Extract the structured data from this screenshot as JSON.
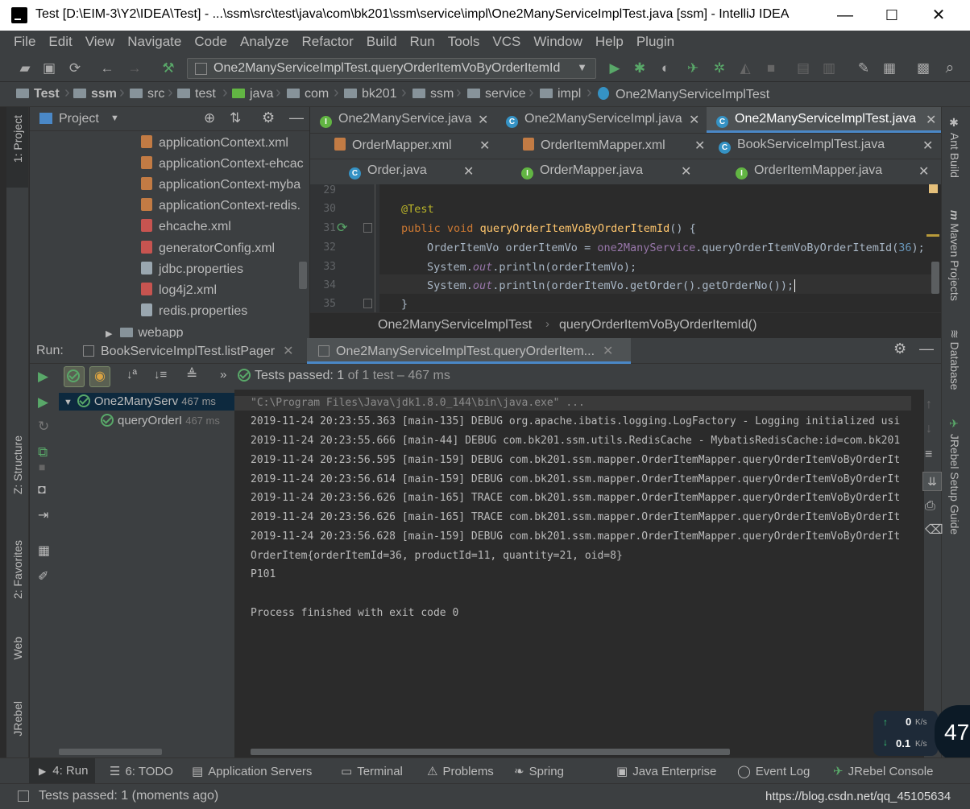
{
  "window": {
    "title": "Test [D:\\EIM-3\\Y2\\IDEA\\Test] - ...\\ssm\\src\\test\\java\\com\\bk201\\ssm\\service\\impl\\One2ManyServiceImplTest.java [ssm] - IntelliJ IDEA",
    "minimize": "—",
    "maximize": "☐",
    "close": "✕"
  },
  "menu": [
    "File",
    "Edit",
    "View",
    "Navigate",
    "Code",
    "Analyze",
    "Refactor",
    "Build",
    "Run",
    "Tools",
    "VCS",
    "Window",
    "Help",
    "Plugin"
  ],
  "toolbar": {
    "run_config": "One2ManyServiceImplTest.queryOrderItemVoByOrderItemId"
  },
  "breadcrumbs": [
    "Test",
    "ssm",
    "src",
    "test",
    "java",
    "com",
    "bk201",
    "ssm",
    "service",
    "impl",
    "One2ManyServiceImplTest"
  ],
  "project": {
    "title": "Project",
    "files": [
      "applicationContext.xml",
      "applicationContext-ehcac",
      "applicationContext-myba",
      "applicationContext-redis.",
      "ehcache.xml",
      "generatorConfig.xml",
      "jdbc.properties",
      "log4j2.xml",
      "redis.properties"
    ],
    "partial_folder": "webapp"
  },
  "left_stripe": {
    "project": "1: Project",
    "structure": "Z: Structure",
    "favorites": "2: Favorites",
    "web": "Web",
    "jrebel": "JRebel"
  },
  "right_stripe": {
    "ant": "Ant Build",
    "maven": "Maven Projects",
    "database": "Database",
    "jrebel": "JRebel Setup Guide"
  },
  "editor_tabs": {
    "row1": [
      "One2ManyService.java",
      "One2ManyServiceImpl.java",
      "One2ManyServiceImplTest.java"
    ],
    "row2": [
      "OrderMapper.xml",
      "OrderItemMapper.xml",
      "BookServiceImplTest.java"
    ],
    "row3": [
      "Order.java",
      "OrderMapper.java",
      "OrderItemMapper.java"
    ]
  },
  "code": {
    "lines": [
      "29",
      "30",
      "31",
      "32",
      "33",
      "34",
      "35"
    ],
    "annotation": "@Test",
    "kw_public": "public",
    "kw_void": "void",
    "method": "queryOrderItemVoByOrderItemId",
    "sig_tail": "() {",
    "l32a": "OrderItemVo orderItemVo = ",
    "l32b": "one2ManyService",
    "l32c": ".queryOrderItemVoByOrderItemId(",
    "l32d": "36",
    "l32e": ");",
    "sys": "System.",
    "out": "out",
    "l33tail": ".println(orderItemVo);",
    "l34tail": ".println(orderItemVo.getOrder().getOrderNo());",
    "close": "}"
  },
  "editor_breadcrumb": {
    "class": "One2ManyServiceImplTest",
    "method": "queryOrderItemVoByOrderItemId()"
  },
  "run": {
    "label": "Run:",
    "tab1": "BookServiceImplTest.listPager",
    "tab2": "One2ManyServiceImplTest.queryOrderItem...",
    "status_prefix": "Tests passed: ",
    "status_count": "1",
    "status_suffix": " of 1 test – 467 ms",
    "tree": [
      {
        "name": "One2ManyServ",
        "time": "467 ms"
      },
      {
        "name": "queryOrderI",
        "time": "467 ms"
      }
    ]
  },
  "console": [
    "\"C:\\Program Files\\Java\\jdk1.8.0_144\\bin\\java.exe\" ...",
    "2019-11-24 20:23:55.363 [main-135] DEBUG org.apache.ibatis.logging.LogFactory - Logging initialized usi",
    "2019-11-24 20:23:55.666 [main-44] DEBUG com.bk201.ssm.utils.RedisCache - MybatisRedisCache:id=com.bk201",
    "2019-11-24 20:23:56.595 [main-159] DEBUG com.bk201.ssm.mapper.OrderItemMapper.queryOrderItemVoByOrderIt",
    "2019-11-24 20:23:56.614 [main-159] DEBUG com.bk201.ssm.mapper.OrderItemMapper.queryOrderItemVoByOrderIt",
    "2019-11-24 20:23:56.626 [main-165] TRACE com.bk201.ssm.mapper.OrderItemMapper.queryOrderItemVoByOrderIt",
    "2019-11-24 20:23:56.626 [main-165] TRACE com.bk201.ssm.mapper.OrderItemMapper.queryOrderItemVoByOrderIt",
    "2019-11-24 20:23:56.628 [main-159] DEBUG com.bk201.ssm.mapper.OrderItemMapper.queryOrderItemVoByOrderIt",
    "OrderItem{orderItemId=36, productId=11, quantity=21, oid=8}",
    "P101",
    "",
    "Process finished with exit code 0"
  ],
  "bottom_tabs": {
    "run": "4: Run",
    "todo": "6: TODO",
    "servers": "Application Servers",
    "terminal": "Terminal",
    "problems": "Problems",
    "spring": "Spring",
    "java_ent": "Java Enterprise",
    "event_log": "Event Log",
    "jrebel": "JRebel Console"
  },
  "status": {
    "message": "Tests passed: 1 (moments ago)",
    "watermark": "https://blog.csdn.net/qq_45105634"
  },
  "net": {
    "up": "0",
    "down": "0.1",
    "unit": "K/s",
    "badge": "47"
  },
  "colors": {
    "keyword": "#cc7832",
    "annotation": "#bbb529",
    "method": "#ffc66d",
    "field": "#9876aa",
    "number": "#6897bb",
    "pass": "#59a869"
  }
}
